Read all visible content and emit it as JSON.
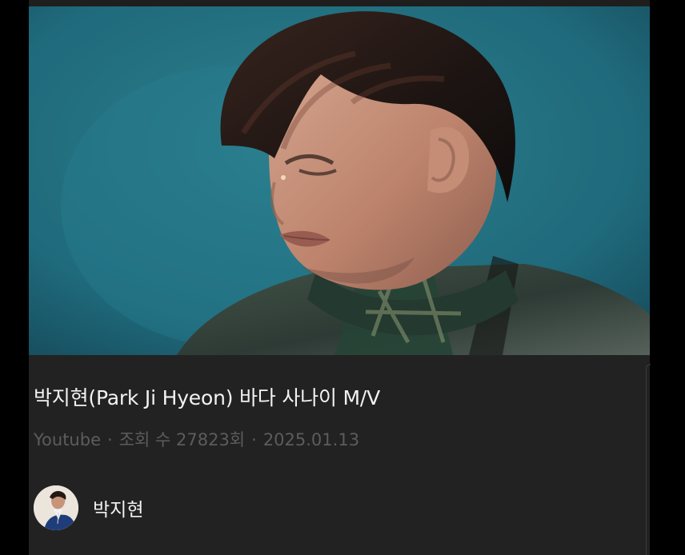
{
  "video": {
    "thumbnail_icon": "music-video-thumbnail",
    "title": "박지현(Park Ji Hyeon) 바다 사나이 M/V",
    "source": "Youtube",
    "separator": "·",
    "views": "조회 수 27823회",
    "date": "2025.01.13"
  },
  "channel": {
    "name": "박지현",
    "avatar_icon": "channel-avatar"
  },
  "colors": {
    "background": "#000000",
    "card": "#222222",
    "title": "#f2f2f2",
    "meta": "#5c5c5c",
    "thumbnail_background": "#1f6a7c"
  }
}
